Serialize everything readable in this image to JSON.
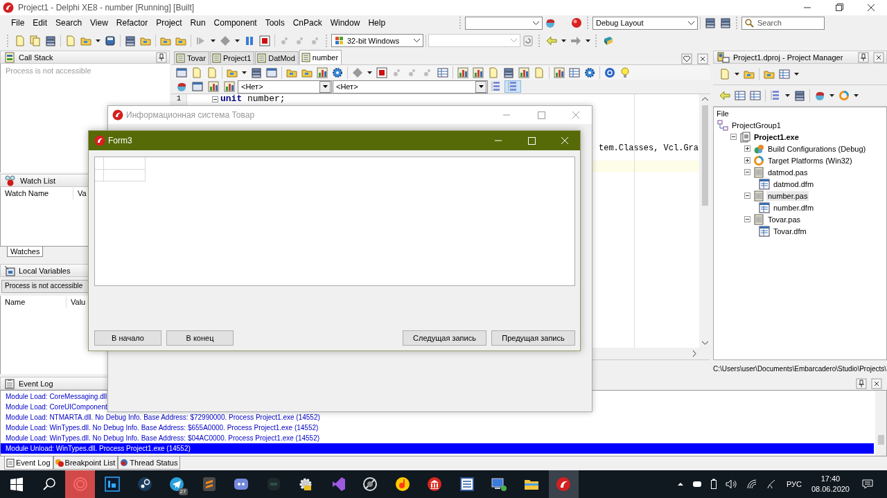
{
  "window": {
    "title": "Project1 - Delphi XE8 - number [Running] [Built]"
  },
  "menu": [
    "File",
    "Edit",
    "Search",
    "View",
    "Refactor",
    "Project",
    "Run",
    "Component",
    "Tools",
    "CnPack",
    "Window",
    "Help"
  ],
  "toolbar": {
    "platform": "32-bit Windows",
    "layout": "Debug Layout",
    "search_placeholder": "Search"
  },
  "call_stack": {
    "title": "Call Stack",
    "message": "Process is not accessible"
  },
  "watch_list": {
    "title": "Watch List",
    "columns": [
      "Watch Name",
      "Va"
    ],
    "tabs": [
      {
        "label": "Watches",
        "selected": true
      }
    ]
  },
  "local_variables": {
    "title": "Local Variables",
    "status": "Process is not accessible",
    "columns": [
      "Name",
      "Valu"
    ]
  },
  "editor": {
    "tabs": [
      {
        "label": "Tovar",
        "selected": false
      },
      {
        "label": "Project1",
        "selected": false
      },
      {
        "label": "DatMod",
        "selected": false
      },
      {
        "label": "number",
        "selected": true
      }
    ],
    "combos": [
      "<Нет>",
      "<Нет>"
    ],
    "line_number": "1",
    "first_line": "**unit** number;",
    "uses_fragment": "tem.Classes, Vcl.Gra"
  },
  "project_manager": {
    "title": "Project1.dproj - Project Manager",
    "column": "File",
    "tree": [
      {
        "label": "ProjectGroup1",
        "kind": "group",
        "selected": false,
        "children": [
          {
            "label": "Project1.exe",
            "kind": "project",
            "expanded": true,
            "selected": false,
            "children": [
              {
                "label": "Build Configurations (Debug)",
                "kind": "config",
                "expanded": false,
                "selected": false
              },
              {
                "label": "Target Platforms (Win32)",
                "kind": "platforms",
                "expanded": false,
                "selected": false
              },
              {
                "label": "datmod.pas",
                "kind": "unit",
                "expanded": true,
                "selected": false,
                "children": [
                  {
                    "label": "datmod.dfm",
                    "kind": "form",
                    "selected": false
                  }
                ]
              },
              {
                "label": "number.pas",
                "kind": "unit",
                "expanded": true,
                "selected": true,
                "children": [
                  {
                    "label": "number.dfm",
                    "kind": "form",
                    "selected": false
                  }
                ]
              },
              {
                "label": "Tovar.pas",
                "kind": "unit",
                "expanded": true,
                "selected": false,
                "children": [
                  {
                    "label": "Tovar.dfm",
                    "kind": "form",
                    "selected": false
                  }
                ]
              }
            ]
          }
        ]
      }
    ],
    "path": "C:\\Users\\user\\Documents\\Embarcadero\\Studio\\Projects\\"
  },
  "event_log": {
    "title": "Event Log",
    "lines": [
      {
        "text": "Module Load: CoreMessaging.dll",
        "selected": false
      },
      {
        "text": "Module Load: CoreUIComponent",
        "selected": false
      },
      {
        "text": "Module Load: NTMARTA.dll. No Debug Info. Base Address: $72990000. Process Project1.exe (14552)",
        "selected": false
      },
      {
        "text": "Module Load: WinTypes.dll. No Debug Info. Base Address: $655A0000. Process Project1.exe (14552)",
        "selected": false
      },
      {
        "text": "Module Load: WinTypes.dll. No Debug Info. Base Address: $04AC0000. Process Project1.exe (14552)",
        "selected": false
      },
      {
        "text": "Module Unload: WinTypes.dll. Process Project1.exe (14552)",
        "selected": true
      }
    ],
    "tabs": [
      {
        "label": "Event Log",
        "selected": true
      },
      {
        "label": "Breakpoint List",
        "selected": false
      },
      {
        "label": "Thread Status",
        "selected": false
      }
    ]
  },
  "info_window": {
    "title": "Информационная система Товар",
    "active": false
  },
  "form3": {
    "title": "Form3",
    "active": true,
    "buttons": [
      "В начало",
      "В конец",
      "Следущая запись",
      "Предущая запись"
    ]
  },
  "taskbar": {
    "apps": [
      {
        "kind": "record",
        "selected": true
      },
      {
        "kind": "photo",
        "selected": false
      },
      {
        "kind": "steam",
        "selected": false
      },
      {
        "kind": "messenger",
        "selected": false,
        "badge": "27"
      },
      {
        "kind": "editor",
        "selected": false
      },
      {
        "kind": "chat",
        "selected": false
      },
      {
        "kind": "emulator",
        "selected": false
      },
      {
        "kind": "tool",
        "selected": false
      },
      {
        "kind": "studio",
        "selected": false
      },
      {
        "kind": "blocked",
        "selected": false
      },
      {
        "kind": "music",
        "selected": false
      },
      {
        "kind": "bank",
        "selected": false
      },
      {
        "kind": "word",
        "selected": false
      },
      {
        "kind": "remote",
        "selected": false
      },
      {
        "kind": "explorer",
        "selected": false
      },
      {
        "kind": "delphi",
        "selected": true
      }
    ],
    "language": "РУС",
    "time": "17:40",
    "date": "08.06.2020"
  }
}
